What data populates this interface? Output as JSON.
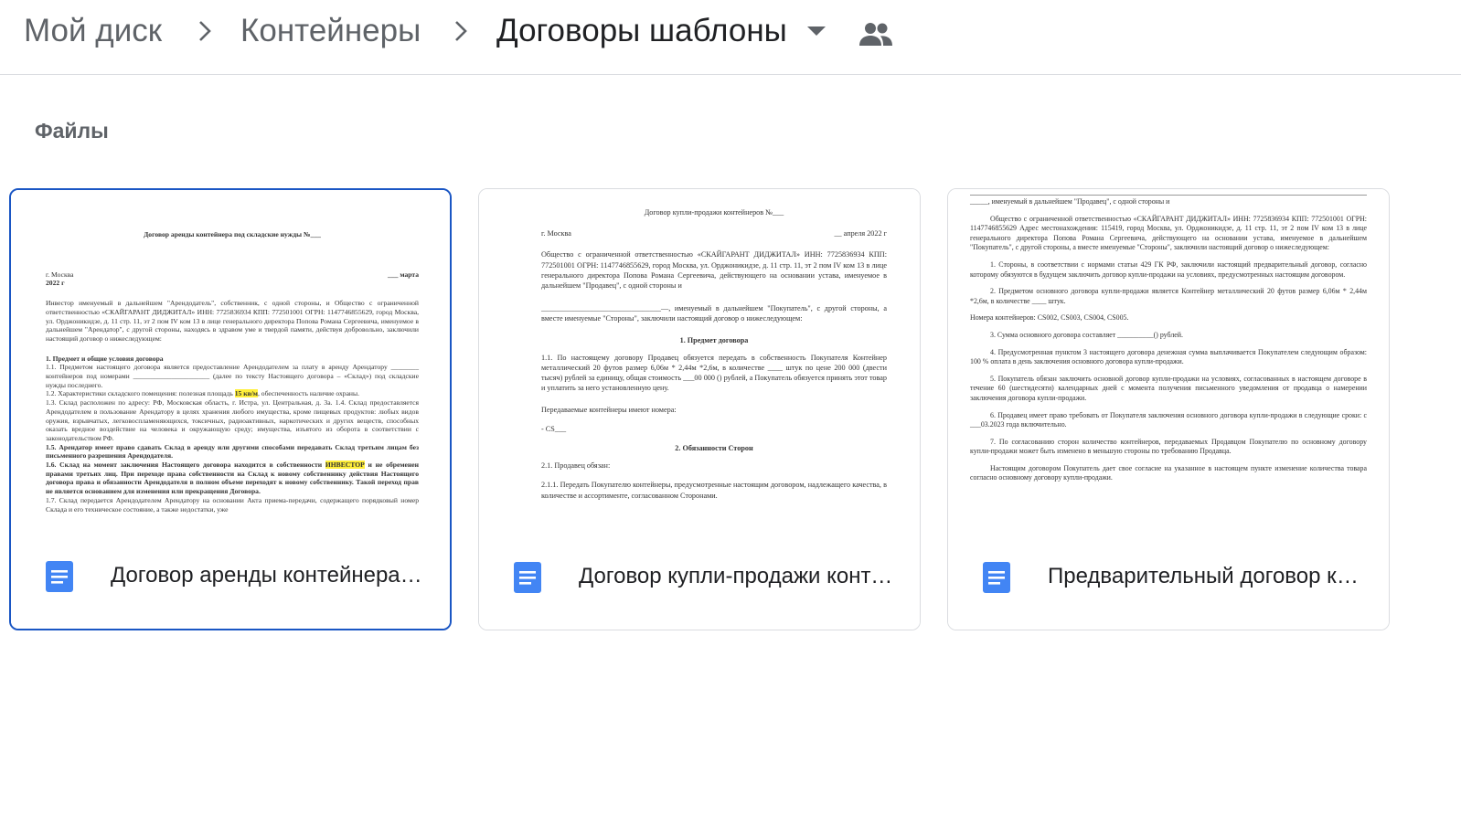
{
  "breadcrumb": {
    "items": [
      "Мой диск",
      "Контейнеры",
      "Договоры шаблоны"
    ]
  },
  "section": {
    "title": "Файлы"
  },
  "colors": {
    "selected_border": "#1a56c4",
    "doc_icon": "#4285f4",
    "highlight": "#ffef3a"
  },
  "files": [
    {
      "name": "Договор аренды контейнера под складские нужды",
      "icon": "google-docs-icon",
      "selected": true,
      "preview": {
        "title": "Договор аренды контейнера под складские нужды №___",
        "city": "г. Москва",
        "year": "2022 г",
        "date": "___ марта",
        "p1": "Инвестор именуемый в дальнейшем \"Арендодатель\", собственник, с одной стороны, и Общество с ограниченной ответственностью «СКАЙГАРАНТ ДИДЖИТАЛ» ИНН: 7725836934 КПП: 772501001 ОГРН: 1147746855629, город Москва, ул. Орджоникидзе, д. 11 стр. 11, эт 2 пом IV ком 13 в лице генерального директора Попова Романа Сергеевича, именуемое в дальнейшем \"Арендатор\", с другой стороны, находясь в здравом уме и твердой памяти, действуя добровольно, заключили настоящий договор о нижеследующем:",
        "heading": "1. Предмет и общие условия договора",
        "p2": "1.1. Предметом настоящего договора является предоставление Арендодателем за плату в аренду Арендатору ________ контейнеров под номерами ______________________ (далее по тексту Настоящего договора – «Склад») под складские нужды последнего.",
        "p3a": "1.2. Характеристики складского помещения: полезная площадь ",
        "p3hl": "15 кв/м",
        "p3b": ", обеспеченность наличие охраны.",
        "p4": "1.3. Склад расположен по адресу: РФ, Московская область, г. Истра, ул. Центральная, д. 3а. 1.4. Склад предоставляется Арендодателем в пользование Арендатору в целях хранения любого имущества, кроме пищевых продуктов: любых видов оружия, взрывчатых, легковоспламеняющихся, токсичных, радиоактивных, наркотических и других веществ, способных оказать вредное воздействие на человека и окружающую среду; имущества, изъятого из оборота в соответствии с законодательством РФ.",
        "p5": "1.5. Арендатор имеет право сдавать Склад в аренду или другими способами передавать Склад третьим лицам без письменного разрешения Арендодателя.",
        "p6a": "1.6. Склад на момент заключения Настоящего договора находится в собственности ",
        "p6hl": "ИНВЕСТОР",
        "p6b": " и не обременен правами третьих лиц. При переходе права собственности на Склад к новому собственнику действия Настоящего договора права и обязанности Арендодателя в полном объеме переходят к новому собственнику. Такой переход прав не является основанием для изменения или прекращения Договора.",
        "p7": "1.7. Склад передается Арендодателем Арендатору на основании Акта приема-передачи, содержащего порядковый номер Склада и его техническое состояние, а также недостатки, уже"
      }
    },
    {
      "name": "Договор купли-продажи контейнеров",
      "icon": "google-docs-icon",
      "selected": false,
      "preview": {
        "title": "Договор купли-продажи контейнеров №___",
        "city": "г. Москва",
        "date": "__ апреля 2022 г",
        "p1": "Общество с ограниченной ответственностью «СКАЙГАРАНТ ДИДЖИТАЛ» ИНН: 7725836934 КПП: 772501001 ОГРН: 1147746855629, город Москва, ул. Орджоникидзе, д. 11 стр. 11, эт 2 пом IV ком 13 в лице генерального директора Попова Романа Сергеевича, действующего на основании устава, именуемое в дальнейшем \"Продавец\", с одной стороны и",
        "p2": "________________________________—, именуемый в дальнейшем \"Покупатель\", с другой стороны, а вместе именуемые \"Стороны\", заключили настоящий договор о нижеследующем:",
        "heading1": "1. Предмет договора",
        "p3": "1.1. По настоящему договору Продавец обязуется передать в собственность Покупателя Контейнер металлический 20 футов размер 6,06м * 2,44м *2,6м, в количестве ____ штук по цене 200 000 (двести тысяч) рублей за единицу, общая стоимость ___00 000 () рублей, а Покупатель обязуется принять этот товар и уплатить за него установленную цену.",
        "p4": "Передаваемые контейнеры имеют номера:",
        "p5": "- CS___",
        "heading2": "2. Обязанности Сторон",
        "p6": "2.1. Продавец обязан:",
        "p7": "2.1.1. Передать Покупателю контейнеры, предусмотренные настоящим договором, надлежащего качества, в количестве и ассортименте, согласованном Сторонами."
      }
    },
    {
      "name": "Предварительный договор купли-продажи",
      "icon": "google-docs-icon",
      "selected": false,
      "preview": {
        "p0": "_____, именуемый в дальнейшем \"Продавец\", с одной стороны и",
        "p1": "Общество с ограниченной ответственностью «СКАЙГАРАНТ ДИДЖИТАЛ» ИНН: 7725836934 КПП: 772501001 ОГРН: 1147746855629 Адрес местонахождения: 115419, город Москва, ул. Орджоникидзе, д. 11 стр. 11, эт 2 пом IV ком 13 в лице генерального директора Попова Романа Сергеевича, действующего на основании устава, именуемое в дальнейшем \"Покупатель\", с другой стороны, а вместе именуемые \"Стороны\", заключили настоящий договор о нижеследующем:",
        "p2": "1. Стороны, в соответствии с нормами статьи 429 ГК РФ, заключили настоящий предварительный договор, согласно которому обязуются в будущем заключить договор купли-продажи на условиях, предусмотренных настоящим договором.",
        "p3": "2. Предметом основного договора купли-продажи является Контейнер металлический 20 футов размер 6,06м * 2,44м *2,6м, в количестве ____ штук.",
        "p4": "Номера контейнеров: CS002, CS003, CS004, CS005.",
        "p5": "3. Сумма основного договора составляет __________() рублей.",
        "p6": "4. Предусмотренная пунктом 3 настоящего договора денежная сумма выплачивается Покупателем следующим образом: 100 % оплата в день заключения основного договора купли-продажи.",
        "p7": "5. Покупатель обязан заключить основной договор купли-продажи на условиях, согласованных в настоящем договоре в течение 60 (шестидесяти) календарных дней с момента получения письменного уведомления от продавца о намерении заключения договора купли-продажи.",
        "p8": "6. Продавец имеет право требовать от Покупателя заключения основного договора купли-продажи в следующие сроки: с ___03.2023 года включительно.",
        "p9": "7. По согласованию сторон количество контейнеров, передаваемых Продавцом Покупателю по основному договору купли-продажи может быть изменено в меньшую стороны по требованию Продавца.",
        "p10": "Настоящим договором Покупатель дает свое согласие на указанное в настоящем пункте изменение количества товара согласно основному договору купли-продажи."
      }
    }
  ]
}
